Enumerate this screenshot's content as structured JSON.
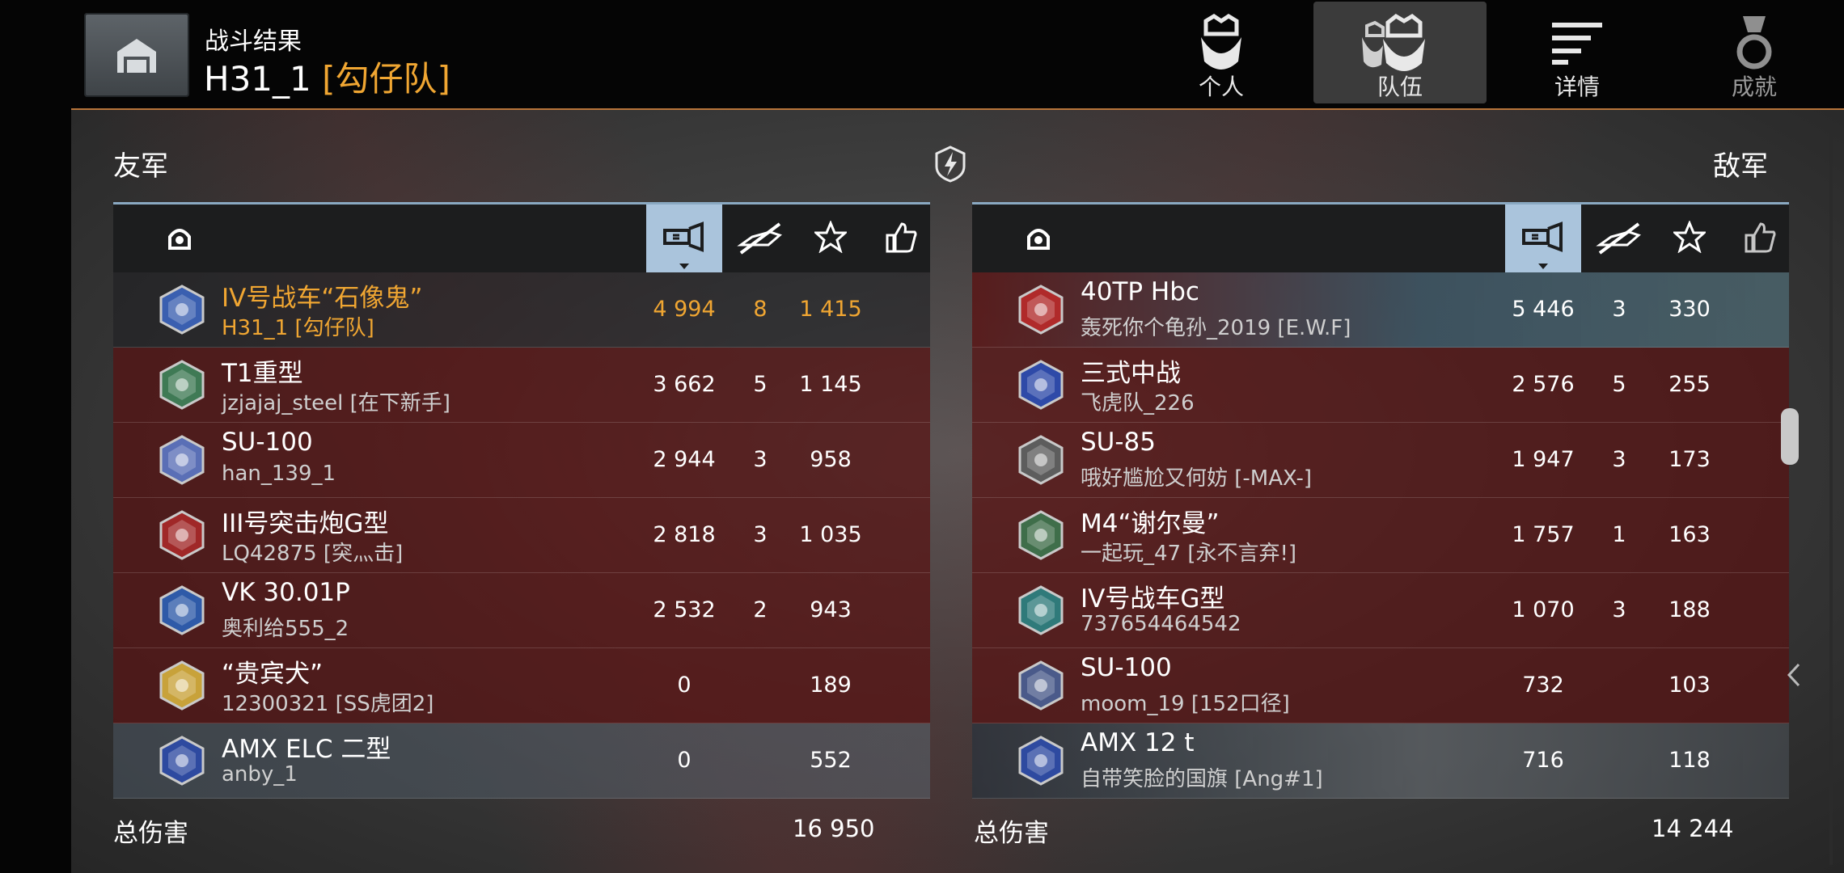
{
  "header": {
    "subtitle": "战斗结果",
    "title_name": "H31_1",
    "title_clan": "[勾仔队]",
    "tabs": [
      {
        "label": "个人",
        "icon": "soldier-icon",
        "state": "normal"
      },
      {
        "label": "队伍",
        "icon": "team-icon",
        "state": "active"
      },
      {
        "label": "详情",
        "icon": "details-list-icon",
        "state": "normal"
      },
      {
        "label": "成就",
        "icon": "medal-icon",
        "state": "dim"
      }
    ]
  },
  "colors": {
    "accent": "#f0a632",
    "ally_row": "#4a1414",
    "enemy_row": "#4a1414",
    "header_active": "#aac4dc",
    "divider": "#b8753a"
  },
  "allies": {
    "label": "友军",
    "columns": [
      "tank-icon",
      "damage-icon",
      "kills-icon",
      "xp-star-icon",
      "like-icon"
    ],
    "rows": [
      {
        "tank": "IV号战车“石像鬼”",
        "player": "H31_1 [勾仔队]",
        "damage": "4 994",
        "kills": "8",
        "xp": "1 415",
        "me": true,
        "badge_color": "#3a5fb0"
      },
      {
        "tank": "T1重型",
        "player": "jzjajaj_steel [在下新手]",
        "damage": "3 662",
        "kills": "5",
        "xp": "1 145",
        "badge_color": "#3f7a55"
      },
      {
        "tank": "SU-100",
        "player": "han_139_1",
        "damage": "2 944",
        "kills": "3",
        "xp": "958",
        "badge_color": "#5a6fb6"
      },
      {
        "tank": "III号突击炮G型",
        "player": "LQ42875 [突灬击]",
        "damage": "2 818",
        "kills": "3",
        "xp": "1 035",
        "badge_color": "#a02828"
      },
      {
        "tank": "VK 30.01P",
        "player": "奥利给555_2",
        "damage": "2 532",
        "kills": "2",
        "xp": "943",
        "badge_color": "#2e5aa8"
      },
      {
        "tank": "“贵宾犬”",
        "player": "12300321 [SS虎团2]",
        "damage": "0",
        "kills": "",
        "xp": "189",
        "badge_color": "#c8a23a"
      },
      {
        "tank": "AMX ELC 二型",
        "player": "anby_1",
        "damage": "0",
        "kills": "",
        "xp": "552",
        "badge_color": "#2e4aa0"
      }
    ],
    "total_label": "总伤害",
    "total_value": "16 950"
  },
  "enemies": {
    "label": "敌军",
    "columns": [
      "tank-icon",
      "damage-icon",
      "kills-icon",
      "xp-star-icon",
      "like-icon"
    ],
    "rows": [
      {
        "tank": "40TP Hbc",
        "player": "轰死你个龟孙_2019 [E.W.F]",
        "damage": "5 446",
        "kills": "3",
        "xp": "330",
        "badge_color": "#b02a2a"
      },
      {
        "tank": "三式中战",
        "player": "飞虎队_226",
        "damage": "2 576",
        "kills": "5",
        "xp": "255",
        "badge_color": "#2e4aa8"
      },
      {
        "tank": "SU-85",
        "player": "哦好尴尬又何妨 [-MAX-]",
        "damage": "1 947",
        "kills": "3",
        "xp": "173",
        "badge_color": "#5d5d5d"
      },
      {
        "tank": "M4“谢尔曼”",
        "player": "一起玩_47 [永不言弃!]",
        "damage": "1 757",
        "kills": "1",
        "xp": "163",
        "badge_color": "#3f6e4a"
      },
      {
        "tank": "IV号战车G型",
        "player": "737654464542",
        "damage": "1 070",
        "kills": "3",
        "xp": "188",
        "badge_color": "#2f7a7a"
      },
      {
        "tank": "SU-100",
        "player": "moom_19 [152口径]",
        "damage": "732",
        "kills": "",
        "xp": "103",
        "badge_color": "#4a5a8a"
      },
      {
        "tank": "AMX 12 t",
        "player": "自带笑脸的国旗 [Ang#1]",
        "damage": "716",
        "kills": "",
        "xp": "118",
        "badge_color": "#2e4aa0"
      }
    ],
    "total_label": "总伤害",
    "total_value": "14 244"
  }
}
